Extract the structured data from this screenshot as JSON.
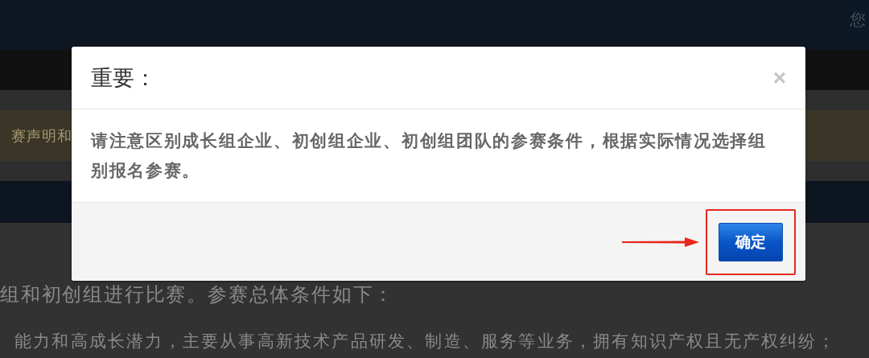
{
  "page": {
    "header_text": "您",
    "notice_text": "赛声明和",
    "paragraphs": [
      "组和初创组进行比赛。参赛总体条件如下：",
      "能力和高成长潜力，主要从事高新技术产品研发、制造、服务等业务，拥有知识产权且无产权纠纷；"
    ]
  },
  "dialog": {
    "title": "重要：",
    "close": "×",
    "message": "请注意区别成长组企业、初创组企业、初创组团队的参赛条件，根据实际情况选择组别报名参赛。",
    "confirm_button": "确定",
    "highlighted": true
  }
}
